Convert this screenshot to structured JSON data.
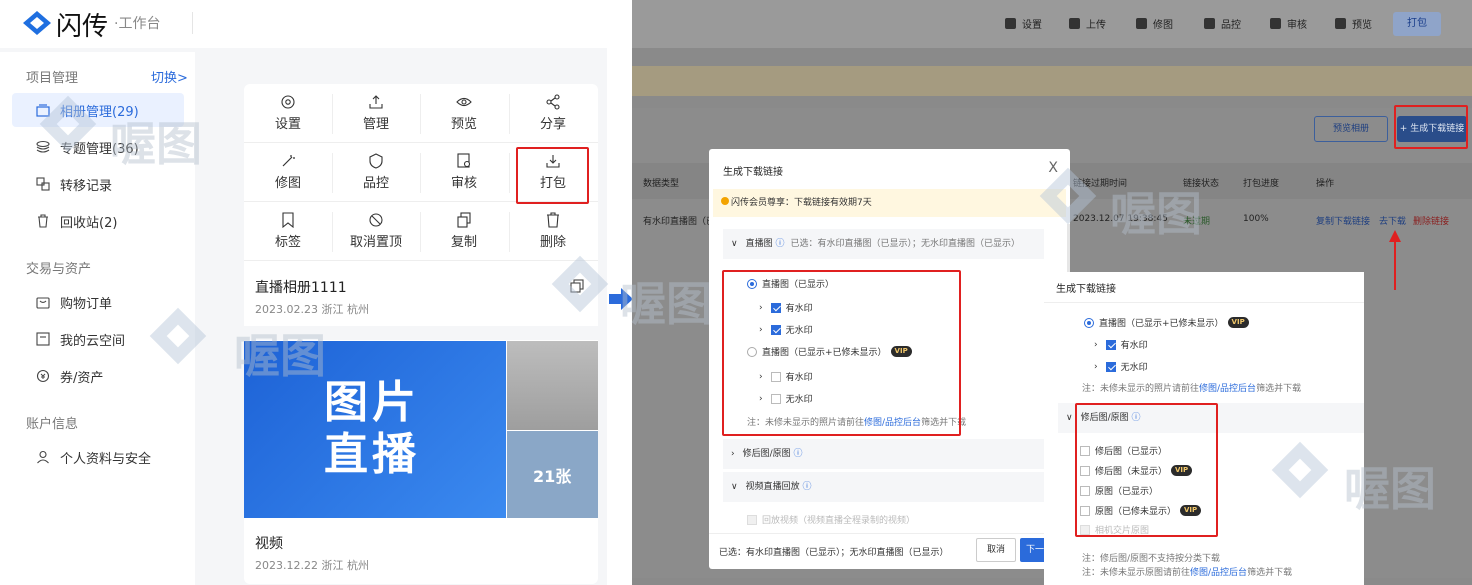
{
  "colors": {
    "primary": "#2b6bdb",
    "highlight": "#e02020",
    "vip_bg": "#2b2b2b",
    "vip_text": "#f1c76a"
  },
  "brand": {
    "name": "闪传",
    "subtitle": "·工作台",
    "icon": "logo-diamond-icon"
  },
  "sidebar": {
    "project_title": "项目管理",
    "switch_label": "切换>",
    "items": [
      {
        "label": "相册管理(29)",
        "icon": "album-icon",
        "active": true
      },
      {
        "label": "专题管理(36)",
        "icon": "layers-icon"
      },
      {
        "label": "转移记录",
        "icon": "transfer-icon"
      },
      {
        "label": "回收站(2)",
        "icon": "trash-icon"
      }
    ],
    "trade_title": "交易与资产",
    "trade_items": [
      {
        "label": "购物订单",
        "icon": "order-icon"
      },
      {
        "label": "我的云空间",
        "icon": "cloud-storage-icon"
      },
      {
        "label": "券/资产",
        "icon": "coupon-icon"
      }
    ],
    "account_title": "账户信息",
    "account_items": [
      {
        "label": "个人资料与安全",
        "icon": "user-icon"
      }
    ]
  },
  "actions": [
    {
      "label": "设置",
      "icon": "gear-icon"
    },
    {
      "label": "管理",
      "icon": "upload-icon"
    },
    {
      "label": "预览",
      "icon": "eye-icon"
    },
    {
      "label": "分享",
      "icon": "share-icon"
    },
    {
      "label": "修图",
      "icon": "wand-icon"
    },
    {
      "label": "品控",
      "icon": "shield-icon"
    },
    {
      "label": "审核",
      "icon": "review-icon"
    },
    {
      "label": "打包",
      "icon": "download-icon"
    },
    {
      "label": "标签",
      "icon": "bookmark-icon"
    },
    {
      "label": "取消置顶",
      "icon": "unpin-icon"
    },
    {
      "label": "复制",
      "icon": "copy-icon"
    },
    {
      "label": "删除",
      "icon": "trash-icon"
    }
  ],
  "album": {
    "title": "直播相册1111",
    "date_location": "2023.02.23 浙江 杭州",
    "cover_text_line1": "图片",
    "cover_text_line2": "直播",
    "count_badge": "21张"
  },
  "video": {
    "title": "视频",
    "date_location": "2023.12.22 浙江 杭州"
  },
  "watermark": "喔图",
  "right_panel": {
    "toolbar": [
      "设置",
      "上传",
      "修图",
      "品控",
      "审核",
      "预览",
      "打包"
    ],
    "btn_preview": "预览相册",
    "btn_generate": "+ 生成下载链接",
    "columns": [
      "数据类型",
      "链接过期时间",
      "链接状态",
      "打包进度",
      "操作"
    ],
    "row": {
      "type": "有水印直播图（已",
      "expire": "2023.12.07 19:38:45",
      "status": "未过期",
      "progress": "100%",
      "op_copy": "复制下载链接",
      "op_download": "去下载",
      "op_delete": "删除链接"
    }
  },
  "modal": {
    "title": "生成下载链接",
    "close": "X",
    "notice": "闪传会员尊享：下载链接有效期7天",
    "sec_live": "直播图",
    "sec_live_selected": "已选：有水印直播图（已显示）；无水印直播图（已显示）",
    "live_shown": "直播图（已显示）",
    "watermark_on": "有水印",
    "watermark_off": "无水印",
    "live_all": "直播图（已显示+已修未显示）",
    "vip": "VIP",
    "note1_pre": "注：未修未显示的照片请前往",
    "note1_link": "修图/品控后台",
    "note1_post": "筛选并下载",
    "sec_retouch": "修后图/原图",
    "sec_video": "视频直播回放",
    "video_opt": "回放视频（视频直播全程录制的视频）",
    "footer_selected": "已选：有水印直播图（已显示）；无水印直播图（已显示）",
    "cancel": "取消",
    "next": "下一"
  },
  "zoom": {
    "title": "生成下载链接",
    "live_all": "直播图（已显示+已修未显示）",
    "vip": "VIP",
    "watermark_on": "有水印",
    "watermark_off": "无水印",
    "note1": "注：未修未显示的照片请前往",
    "note1_link": "修图/品控后台",
    "note1_post": "筛选并下载",
    "sec_retouch": "修后图/原图",
    "opts": [
      "修后图（已显示）",
      "修后图（未显示）",
      "原图（已显示）",
      "原图（已修未显示）",
      "相机交片原图"
    ],
    "note2": "注：修后图/原图不支持按分类下载",
    "note3_pre": "注：未修未显示原图请前往",
    "note3_link": "修图/品控后台",
    "note3_post": "筛选并下载"
  }
}
